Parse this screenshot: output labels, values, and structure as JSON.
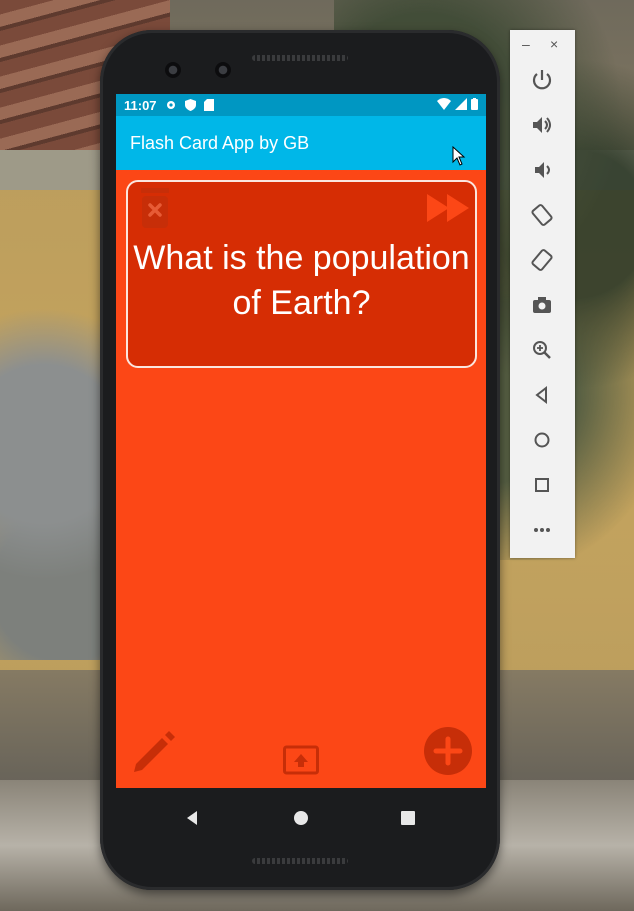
{
  "status_bar": {
    "time": "11:07",
    "icons": [
      "settings-icon",
      "shield-icon",
      "sd-card-icon",
      "wifi-icon",
      "signal-icon",
      "battery-icon"
    ]
  },
  "app_bar": {
    "title": "Flash Card App by GB"
  },
  "card": {
    "question": "What is the population of Earth?",
    "delete_icon": "delete-icon",
    "next_icon": "fast-forward-icon"
  },
  "bottom_actions": {
    "edit_icon": "edit-pencil-icon",
    "upload_icon": "upload-icon",
    "add_icon": "add-circle-icon"
  },
  "nav_bar": [
    "back-icon",
    "home-icon",
    "recents-icon"
  ],
  "emulator_toolbar": {
    "minimize": "–",
    "close": "×",
    "buttons": [
      "power-icon",
      "volume-up-icon",
      "volume-down-icon",
      "rotate-left-icon",
      "rotate-right-icon",
      "camera-icon",
      "zoom-icon",
      "back-icon",
      "home-icon",
      "overview-icon",
      "more-icon"
    ]
  },
  "colors": {
    "screen_bg": "#fc4716",
    "card_bg": "#d62d04",
    "app_bar": "#00b7e8",
    "status_bar": "#0097c2",
    "icon_dark": "#c72e08"
  }
}
